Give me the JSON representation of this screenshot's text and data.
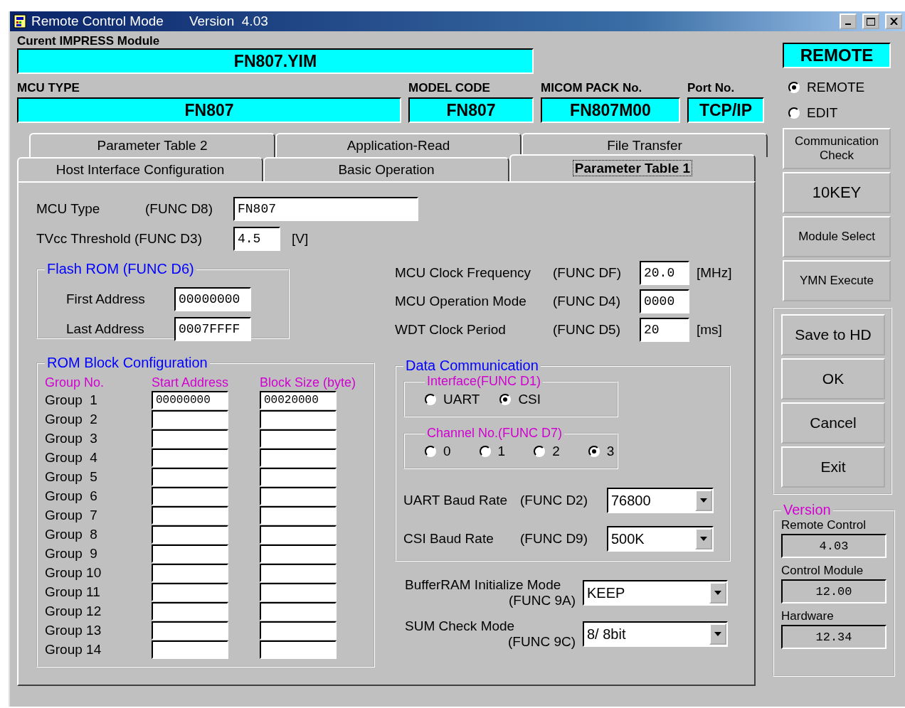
{
  "window": {
    "title": "Remote Control Mode",
    "version": "Version  4.03"
  },
  "module": {
    "label": "Curent IMPRESS Module",
    "value": "FN807.YIM"
  },
  "info_fields": [
    {
      "label": "MCU TYPE",
      "value": "FN807"
    },
    {
      "label": "MODEL CODE",
      "value": "FN807"
    },
    {
      "label": "MICOM PACK No.",
      "value": "FN807M00"
    },
    {
      "label": "Port No.",
      "value": "TCP/IP"
    }
  ],
  "mode_badge": "REMOTE",
  "mode_options": [
    {
      "label": "REMOTE",
      "selected": true
    },
    {
      "label": "EDIT",
      "selected": false
    }
  ],
  "tool_buttons": [
    "Communication Check",
    "10KEY",
    "Module Select",
    "YMN Execute"
  ],
  "tabs_back": [
    {
      "label": "Parameter Table 2",
      "selected": false
    },
    {
      "label": "Application-Read",
      "selected": false
    },
    {
      "label": "File Transfer",
      "selected": false
    }
  ],
  "tabs_front": [
    {
      "label": "Host Interface Configuration",
      "selected": false
    },
    {
      "label": "Basic Operation",
      "selected": false
    },
    {
      "label": "Parameter Table 1",
      "selected": true
    }
  ],
  "mcu_type": {
    "label": "MCU Type",
    "func": "(FUNC D8)",
    "value": "FN807"
  },
  "tvcc": {
    "label": "TVcc Threshold (FUNC D3)",
    "value": "4.5",
    "unit": "[V]"
  },
  "flash_rom": {
    "title": "Flash ROM (FUNC D6)",
    "rows": [
      {
        "label": "First Address",
        "value": "00000000"
      },
      {
        "label": "Last Address",
        "value": "0007FFFF"
      }
    ]
  },
  "clock_rows": [
    {
      "label": "MCU Clock Frequency",
      "func": "(FUNC DF)",
      "value": "20.0",
      "unit": "[MHz]"
    },
    {
      "label": "MCU Operation Mode",
      "func": "(FUNC D4)",
      "value": "0000"
    },
    {
      "label": "WDT Clock Period",
      "func": "(FUNC D5)",
      "value": "20",
      "unit": "[ms]"
    }
  ],
  "rom_block": {
    "title": "ROM Block Configuration",
    "columns": [
      "Group No.",
      "Start Address",
      "Block Size (byte)"
    ],
    "rows": [
      {
        "group": "Group  1",
        "start": "00000000",
        "size": "00020000"
      },
      {
        "group": "Group  2"
      },
      {
        "group": "Group  3"
      },
      {
        "group": "Group  4"
      },
      {
        "group": "Group  5"
      },
      {
        "group": "Group  6"
      },
      {
        "group": "Group  7"
      },
      {
        "group": "Group  8"
      },
      {
        "group": "Group  9"
      },
      {
        "group": "Group 10"
      },
      {
        "group": "Group 11"
      },
      {
        "group": "Group 12"
      },
      {
        "group": "Group 13"
      },
      {
        "group": "Group 14"
      }
    ]
  },
  "data_comm": {
    "title": "Data Communication",
    "interface": {
      "title": "Interface(FUNC D1)",
      "options": [
        {
          "label": "UART",
          "selected": false
        },
        {
          "label": "CSI",
          "selected": true
        }
      ]
    },
    "channel": {
      "title": "Channel No.(FUNC D7)",
      "options": [
        {
          "label": "0",
          "selected": false
        },
        {
          "label": "1",
          "selected": false
        },
        {
          "label": "2",
          "selected": false
        },
        {
          "label": "3",
          "selected": true
        }
      ]
    },
    "selects": [
      {
        "label": "UART Baud Rate",
        "func": "(FUNC D2)",
        "value": "76800"
      },
      {
        "label": "CSI Baud Rate",
        "func": "(FUNC D9)",
        "value": "500K"
      }
    ]
  },
  "buffer_ram": {
    "label": "BufferRAM Initialize Mode",
    "func": "(FUNC 9A)",
    "value": "KEEP"
  },
  "sum_check": {
    "label": "SUM Check Mode",
    "func": "(FUNC 9C)",
    "value": "8/ 8bit"
  },
  "action_buttons": [
    "Save to HD",
    "OK",
    "Cancel",
    "Exit"
  ],
  "version": {
    "title": "Version",
    "items": [
      {
        "label": "Remote Control",
        "value": "4.03"
      },
      {
        "label": "Control Module",
        "value": "12.00"
      },
      {
        "label": "Hardware",
        "value": "12.34"
      }
    ]
  }
}
